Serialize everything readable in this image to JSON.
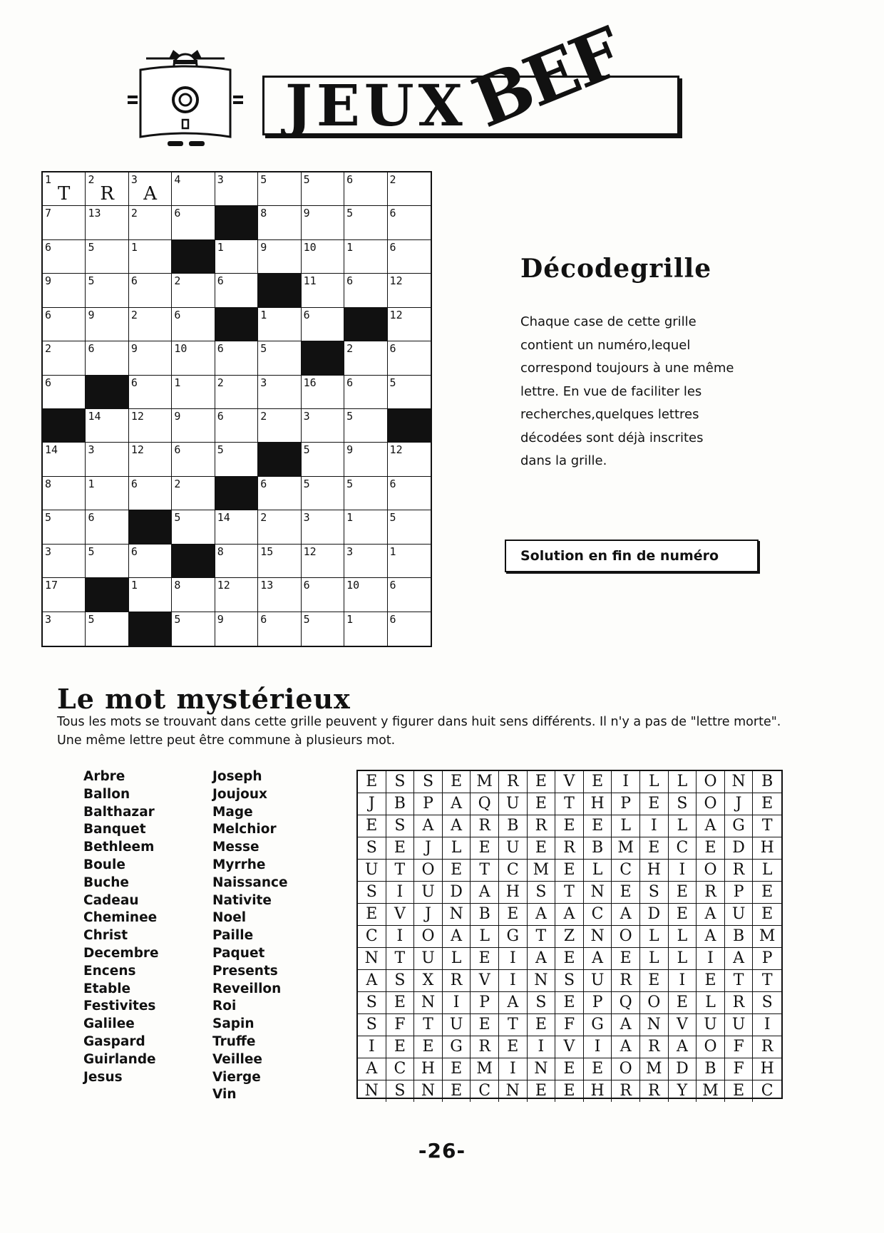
{
  "header": {
    "title_jeux": "JEUX",
    "title_bef": "BEF"
  },
  "decodegrille": {
    "title": "Décodegrille",
    "description": "Chaque case de cette grille contient un numéro,lequel correspond toujours à une même lettre. En vue de faciliter les recherches,quelques lettres décodées sont déjà inscrites dans la grille.",
    "solution_label": "Solution en fin de numéro",
    "rows": [
      [
        "1",
        "2",
        "3",
        "4",
        "3",
        "5",
        "5",
        "6",
        "2"
      ],
      [
        "7",
        "13",
        "2",
        "6",
        "#",
        "8",
        "9",
        "5",
        "6"
      ],
      [
        "6",
        "5",
        "1",
        "#",
        "1",
        "9",
        "10",
        "1",
        "6"
      ],
      [
        "9",
        "5",
        "6",
        "2",
        "6",
        "#",
        "11",
        "6",
        "12"
      ],
      [
        "6",
        "9",
        "2",
        "6",
        "#",
        "1",
        "6",
        "#",
        "12"
      ],
      [
        "2",
        "6",
        "9",
        "10",
        "6",
        "5",
        "#",
        "2",
        "6"
      ],
      [
        "6",
        "#",
        "6",
        "1",
        "2",
        "3",
        "16",
        "6",
        "5"
      ],
      [
        "#",
        "14",
        "12",
        "9",
        "6",
        "2",
        "3",
        "5",
        "#"
      ],
      [
        "14",
        "3",
        "12",
        "6",
        "5",
        "#",
        "5",
        "9",
        "12"
      ],
      [
        "8",
        "1",
        "6",
        "2",
        "#",
        "6",
        "5",
        "5",
        "6"
      ],
      [
        "5",
        "6",
        "#",
        "5",
        "14",
        "2",
        "3",
        "1",
        "5"
      ],
      [
        "3",
        "5",
        "6",
        "#",
        "8",
        "15",
        "12",
        "3",
        "1"
      ],
      [
        "17",
        "#",
        "1",
        "8",
        "12",
        "13",
        "6",
        "10",
        "6"
      ],
      [
        "3",
        "5",
        "#",
        "5",
        "9",
        "6",
        "5",
        "1",
        "6"
      ]
    ],
    "given_letters": [
      "T",
      "R",
      "A"
    ]
  },
  "mot_mysterieux": {
    "title": "Le mot mystérieux",
    "description": "Tous les mots se trouvant dans cette grille peuvent y figurer dans huit sens différents. Il n'y a pas de \"lettre morte\". Une même lettre peut être commune à plusieurs mot.",
    "words_left": [
      "Arbre",
      "Ballon",
      "Balthazar",
      "Banquet",
      "Bethleem",
      "Boule",
      "Buche",
      "Cadeau",
      "Cheminee",
      "Christ",
      "Decembre",
      "Encens",
      "Etable",
      "Festivites",
      "Galilee",
      "Gaspard",
      "Guirlande",
      "Jesus"
    ],
    "words_right": [
      "Joseph",
      "Joujoux",
      "Mage",
      "Melchior",
      "Messe",
      "Myrrhe",
      "Naissance",
      "Nativite",
      "Noel",
      "Paille",
      "Paquet",
      "Presents",
      "Reveillon",
      "Roi",
      "Sapin",
      "Truffe",
      "Veillee",
      "Vierge",
      "Vin"
    ],
    "grid": [
      "ESSEMREVEILLONB",
      "JBPAQUETHPESOJE",
      "ESAARBREELILAGT",
      "SEJLEUERBMECEDH",
      "UTOETCMELCHIORL",
      "SIUDAHSTNESERPE",
      "EVJNBEAACADEAUE",
      "CIOALGTZNOLLABM",
      "NTULEIAEAELLIAP",
      "ASXRVINSUREIETT",
      "SENIPASEPQOELRS",
      "SFTUETEFGANVUUI",
      "IEEGREIVIARAOFR",
      "ACHEMINEEOMDBFH",
      "NSNECNEEHRRYMEC"
    ]
  },
  "footer": {
    "page_number": "-26-"
  }
}
